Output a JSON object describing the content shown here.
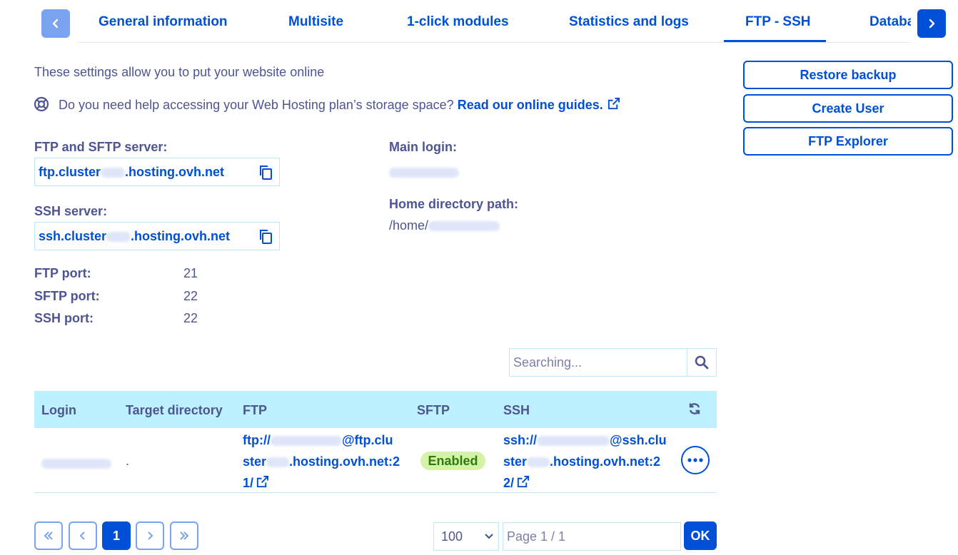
{
  "tabs": {
    "items": [
      {
        "label": "General information"
      },
      {
        "label": "Multisite"
      },
      {
        "label": "1-click modules"
      },
      {
        "label": "Statistics and logs"
      },
      {
        "label": "FTP - SSH"
      },
      {
        "label": "Databa"
      }
    ],
    "active": "FTP - SSH"
  },
  "intro": {
    "text": "These settings allow you to put your website online",
    "help_text": "Do you need help accessing your Web Hosting plan’s storage space?",
    "help_link": "Read our online guides."
  },
  "ftp_server": {
    "label": "FTP and SFTP server:",
    "prefix": "ftp.cluster",
    "suffix": ".hosting.ovh.net"
  },
  "ssh_server": {
    "label": "SSH server:",
    "prefix": "ssh.cluster",
    "suffix": ".hosting.ovh.net"
  },
  "ports": {
    "ftp_label": "FTP port:",
    "ftp_value": "21",
    "sftp_label": "SFTP port:",
    "sftp_value": "22",
    "ssh_label": "SSH port:",
    "ssh_value": "22"
  },
  "login": {
    "main_label": "Main login:",
    "home_label": "Home directory path:",
    "home_prefix": "/home/"
  },
  "actions": {
    "restore": "Restore backup",
    "create_user": "Create User",
    "ftp_explorer": "FTP Explorer"
  },
  "search": {
    "placeholder": "Searching..."
  },
  "table": {
    "headers": {
      "login": "Login",
      "target": "Target directory",
      "ftp": "FTP",
      "sftp": "SFTP",
      "ssh": "SSH"
    },
    "rows": [
      {
        "target": ".",
        "ftp_l1_prefix": "ftp://",
        "ftp_l1_suffix": "@ftp.clu",
        "ftp_l2_prefix": "ster",
        "ftp_l2_suffix": ".hosting.ovh.net:2",
        "ftp_l3": "1/",
        "sftp": "Enabled",
        "ssh_l1_prefix": "ssh://",
        "ssh_l1_suffix": "@ssh.clu",
        "ssh_l2_prefix": "ster",
        "ssh_l2_suffix": ".hosting.ovh.net:2",
        "ssh_l3": "2/"
      }
    ]
  },
  "pagination": {
    "current": "1",
    "page_size": "100",
    "page_placeholder": "Page 1 / 1",
    "ok": "OK"
  },
  "colors": {
    "accent": "#0050d7",
    "text": "#4d5592",
    "table_header": "#bef1ff",
    "badge_bg": "#d4f3a6"
  }
}
